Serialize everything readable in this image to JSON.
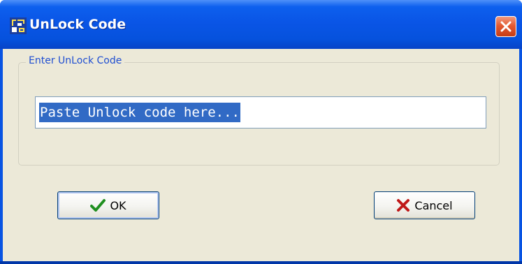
{
  "window": {
    "title": "UnLock Code",
    "app_icon": "app-icon",
    "close_icon": "close-icon"
  },
  "group": {
    "label": "Enter UnLock Code"
  },
  "unlock_input": {
    "value": "Paste Unlock code here..."
  },
  "buttons": {
    "ok_label": "OK",
    "ok_icon": "checkmark-icon",
    "cancel_label": "Cancel",
    "cancel_icon": "x-mark-icon"
  },
  "colors": {
    "title_bar": "#0a55e6",
    "dialog_background": "#ece9d8",
    "group_label": "#1f4ed1",
    "selection": "#316ac5",
    "ok_check": "#1f8f1f",
    "cancel_x": "#c01818"
  }
}
